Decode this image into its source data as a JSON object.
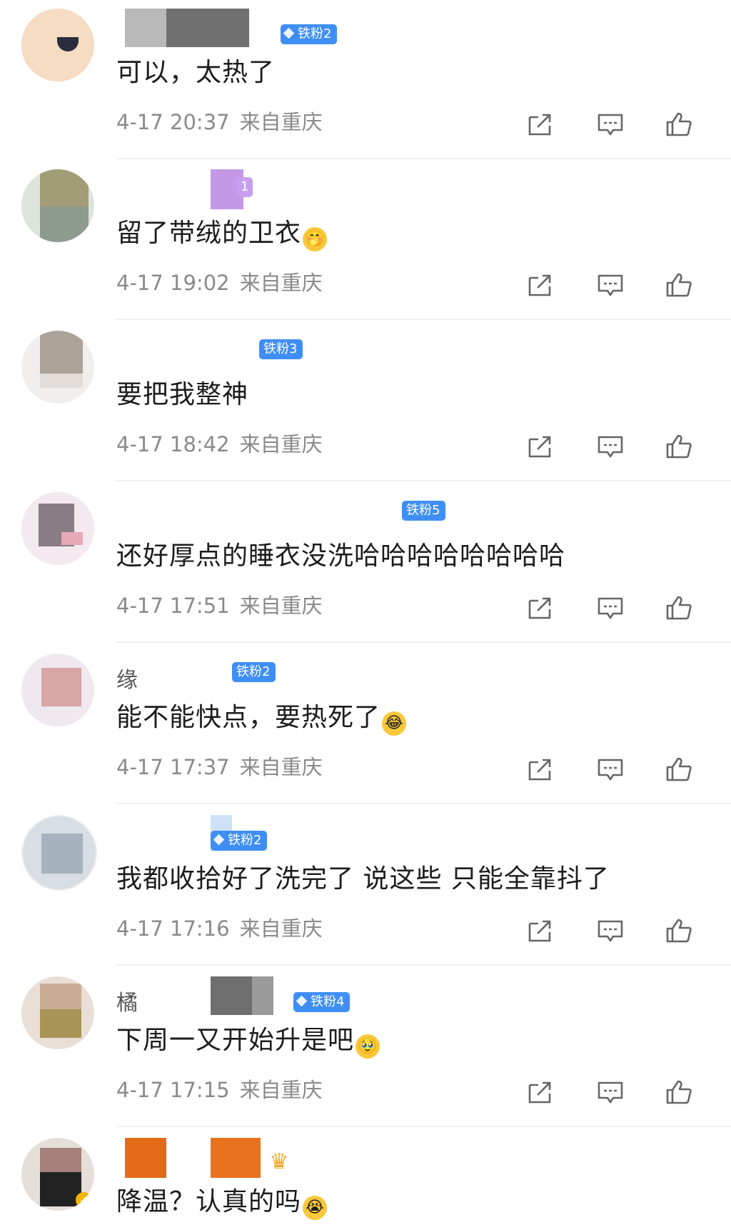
{
  "comments": [
    {
      "username": "",
      "badge": "铁粉2",
      "badge_diamond": true,
      "text": "可以，太热了",
      "emoji": "",
      "time": "4-17 20:37",
      "location": "来自重庆"
    },
    {
      "username": "",
      "badge": "1",
      "badge_diamond": false,
      "text": "留了带绒的卫衣",
      "emoji": "🤭",
      "time": "4-17 19:02",
      "location": "来自重庆"
    },
    {
      "username": "",
      "badge": "铁粉3",
      "badge_diamond": false,
      "text": "要把我整神",
      "emoji": "",
      "time": "4-17 18:42",
      "location": "来自重庆"
    },
    {
      "username": "",
      "badge": "铁粉5",
      "badge_diamond": false,
      "text": "还好厚点的睡衣没洗哈哈哈哈哈哈哈哈",
      "emoji": "",
      "time": "4-17 17:51",
      "location": "来自重庆"
    },
    {
      "username": "缘",
      "badge": "铁粉2",
      "badge_diamond": false,
      "text": "能不能快点，要热死了",
      "emoji": "😂",
      "time": "4-17 17:37",
      "location": "来自重庆"
    },
    {
      "username": "",
      "badge": "铁粉2",
      "badge_diamond": true,
      "text": "我都收拾好了洗完了 说这些 只能全靠抖了",
      "emoji": "",
      "time": "4-17 17:16",
      "location": "来自重庆"
    },
    {
      "username": "橘",
      "badge": "铁粉4",
      "badge_diamond": true,
      "text": "下周一又开始升是吧",
      "emoji": "🥹",
      "time": "4-17 17:15",
      "location": "来自重庆"
    },
    {
      "username": "",
      "badge": "",
      "badge_diamond": false,
      "text": "降温？认真的吗",
      "emoji": "😭",
      "time": "",
      "location": ""
    }
  ],
  "icons": {
    "share": "share-icon",
    "reply": "reply-icon",
    "like": "like-icon"
  },
  "colors": {
    "badge": "#3f8ef5",
    "meta": "#8a8a8a",
    "text": "#1c1c1c"
  }
}
